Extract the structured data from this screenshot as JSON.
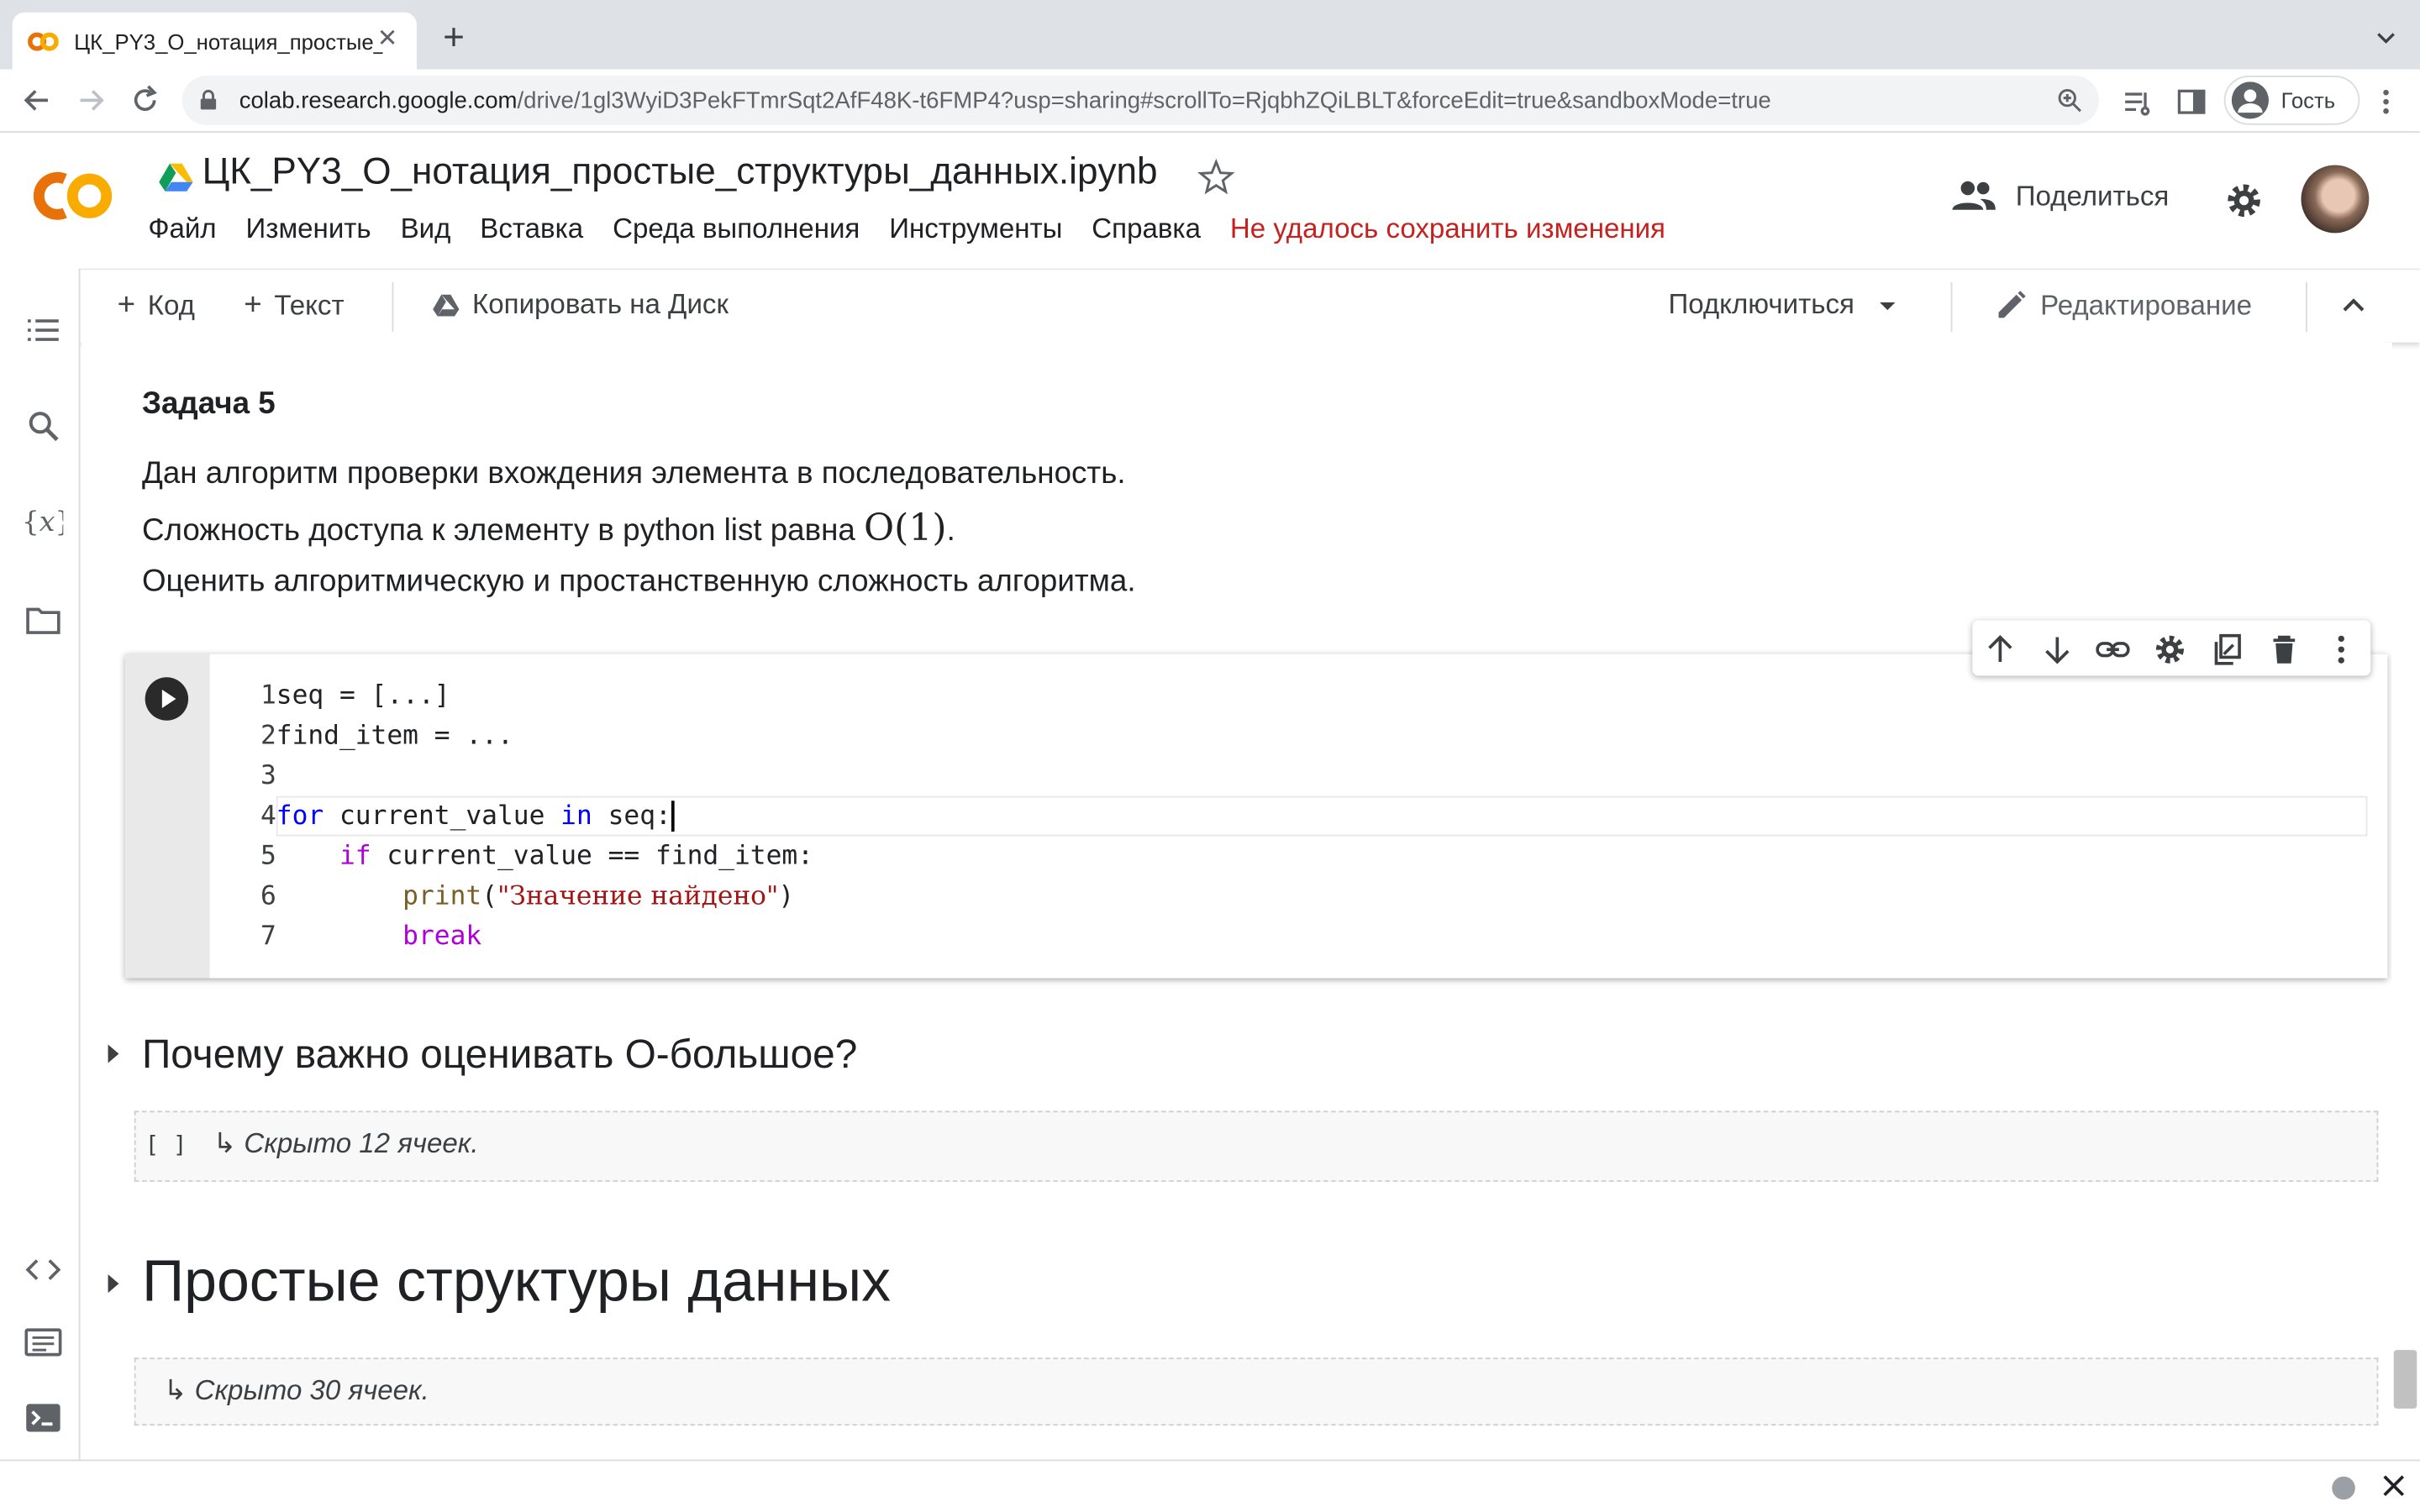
{
  "browser": {
    "tab_title": "ЦК_PY3_O_нотация_простые_структуры_данных.ipynb",
    "url_host": "colab.research.google.com",
    "url_path": "/drive/1gl3WyiD3PekFTmrSqt2AfF48K-t6FMP4?usp=sharing#scrollTo=RjqbhZQiLBLT&forceEdit=true&sandboxMode=true",
    "profile_label": "Гость"
  },
  "header": {
    "doc_title": "ЦК_PY3_O_нотация_простые_структуры_данных.ipynb",
    "menu": [
      "Файл",
      "Изменить",
      "Вид",
      "Вставка",
      "Среда выполнения",
      "Инструменты",
      "Справка"
    ],
    "save_error": "Не удалось сохранить изменения",
    "share_label": "Поделиться"
  },
  "toolbar": {
    "add_code": "Код",
    "add_text": "Текст",
    "copy_to_drive": "Копировать на Диск",
    "connect": "Подключиться",
    "editing": "Редактирование"
  },
  "task": {
    "title": "Задача 5",
    "line1": "Дан алгоритм проверки вхождения элемента в последовательность.",
    "line2_prefix": "Сложность доступа к элементу в python list равна ",
    "line2_math": "O(1)",
    "line2_suffix": ".",
    "line3": "Оценить алгоритмическую и простанственную сложность алгоритма."
  },
  "code": {
    "line_numbers": [
      "1",
      "2",
      "3",
      "4",
      "5",
      "6",
      "7"
    ],
    "l1": "seq = [...]",
    "l2": "find_item = ...",
    "l4_kw_for": "for",
    "l4_mid": " current_value ",
    "l4_kw_in": "in",
    "l4_end": " seq:",
    "l5_kw_if": "if",
    "l5_rest": " current_value == find_item:",
    "l6_fn": "print",
    "l6_open": "(",
    "l6_str": "\"Значение найдено\"",
    "l6_close": ")",
    "l7_kw_break": "break"
  },
  "sections": [
    {
      "heading": "Почему важно оценивать O-большое?",
      "hidden_brackets": "[ ]",
      "hidden_text": "↳ Скрыто 12 ячеек."
    },
    {
      "heading": "Простые структуры данных",
      "hidden_text": "↳ Скрыто 30 ячеек."
    }
  ],
  "colors": {
    "error": "#c5221f",
    "keyword_blue": "#0000ff",
    "keyword_purple": "#af00db",
    "string": "#a31515",
    "colab_orange": "#f9ab00"
  }
}
